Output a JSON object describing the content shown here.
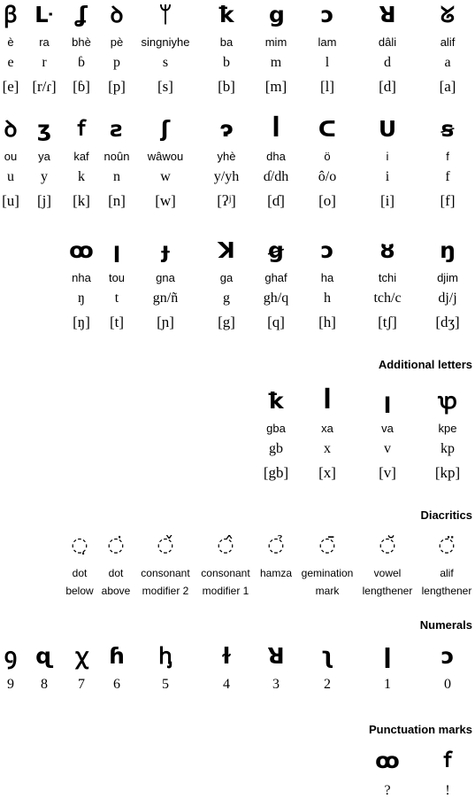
{
  "main_rows": [
    [
      {
        "glyph": "ꞵ",
        "name": "è",
        "roman": "e",
        "ipa": "[e]"
      },
      {
        "glyph": "ᒷ",
        "name": "ra",
        "roman": "r",
        "ipa": "[r/ɾ]"
      },
      {
        "glyph": "ʆ",
        "name": "bhè",
        "roman": "ɓ",
        "ipa": "[ɓ]"
      },
      {
        "glyph": "ꝺ",
        "name": "pè",
        "roman": "p",
        "ipa": "[p]"
      },
      {
        "glyph": "ᛘ",
        "name": "singniyhe",
        "roman": "s",
        "ipa": "[s]"
      },
      {
        "glyph": "ꝁ",
        "name": "ba",
        "roman": "b",
        "ipa": "[b]"
      },
      {
        "glyph": "ց",
        "name": "mim",
        "roman": "m",
        "ipa": "[m]"
      },
      {
        "glyph": "ↄ",
        "name": "lam",
        "roman": "l",
        "ipa": "[l]"
      },
      {
        "glyph": "ꓤ",
        "name": "dâli",
        "roman": "d",
        "ipa": "[d]"
      },
      {
        "glyph": "ᘜ",
        "name": "alif",
        "roman": "a",
        "ipa": "[a]"
      }
    ],
    [
      {
        "glyph": "ꝺ",
        "name": "ou",
        "roman": "u",
        "ipa": "[u]"
      },
      {
        "glyph": "ʒ",
        "name": "ya",
        "roman": "y",
        "ipa": "[j]"
      },
      {
        "glyph": "ꬵ",
        "name": "kaf",
        "roman": "k",
        "ipa": "[k]"
      },
      {
        "glyph": "ƨ",
        "name": "noûn",
        "roman": "n",
        "ipa": "[n]"
      },
      {
        "glyph": "ʃ",
        "name": "wâwou",
        "roman": "w",
        "ipa": "[w]"
      },
      {
        "glyph": "ɂ",
        "name": "yhè",
        "roman": "y/yh",
        "ipa": "[ʔʲ]"
      },
      {
        "glyph": "ꟾ",
        "name": "dha",
        "roman": "ɗ/dh",
        "ipa": "[ɗ]"
      },
      {
        "glyph": "ᑕ",
        "name": "ö",
        "roman": "ô/o",
        "ipa": "[o]"
      },
      {
        "glyph": "ᑌ",
        "name": "i",
        "roman": "i",
        "ipa": "[i]"
      },
      {
        "glyph": "ꞩ",
        "name": "f",
        "roman": "f",
        "ipa": "[f]"
      }
    ],
    [
      {
        "glyph": "ꝏ",
        "name": "nha",
        "roman": "ŋ",
        "ipa": "[ŋ]"
      },
      {
        "glyph": "ꞁ",
        "name": "tou",
        "roman": "t",
        "ipa": "[t]"
      },
      {
        "glyph": "ɟ",
        "name": "gna",
        "roman": "gn/ñ",
        "ipa": "[ɲ]"
      },
      {
        "glyph": "ꓘ",
        "name": "ga",
        "roman": "g",
        "ipa": "[g]"
      },
      {
        "glyph": "ꞡ",
        "name": "ghaf",
        "roman": "gh/q",
        "ipa": "[q]"
      },
      {
        "glyph": "ↄ",
        "name": "ha",
        "roman": "h",
        "ipa": "[h]"
      },
      {
        "glyph": "ȣ",
        "name": "tchi",
        "roman": "tch/c",
        "ipa": "[tʃ]"
      },
      {
        "glyph": "ŋ",
        "name": "djim",
        "roman": "dj/j",
        "ipa": "[dʒ]"
      }
    ]
  ],
  "sections": {
    "additional": "Additional letters",
    "diacritics": "Diacritics",
    "numerals": "Numerals",
    "punctuation": "Punctuation marks"
  },
  "additional_letters": [
    {
      "glyph": "ꝁ",
      "name": "gba",
      "roman": "gb",
      "ipa": "[gb]"
    },
    {
      "glyph": "ꟾ",
      "name": "xa",
      "roman": "x",
      "ipa": "[x]"
    },
    {
      "glyph": "ꞁ",
      "name": "va",
      "roman": "v",
      "ipa": "[v]"
    },
    {
      "glyph": "ꝕ",
      "name": "kpe",
      "roman": "kp",
      "ipa": "[kp]"
    }
  ],
  "diacritics": [
    {
      "glyph": "◌̣",
      "line1": "dot",
      "line2": "below"
    },
    {
      "glyph": "◌̇",
      "line1": "dot",
      "line2": "above"
    },
    {
      "glyph": "◌̌",
      "line1": "consonant",
      "line2": "modifier 2"
    },
    {
      "glyph": "◌̂",
      "line1": "consonant",
      "line2": "modifier 1"
    },
    {
      "glyph": "◌̉",
      "line1": "hamza",
      "line2": ""
    },
    {
      "glyph": "◌̄",
      "line1": "gemination",
      "line2": "mark"
    },
    {
      "glyph": "◌̆",
      "line1": "vowel",
      "line2": "lengthener"
    },
    {
      "glyph": "◌̈",
      "line1": "alif",
      "line2": "lengthener"
    }
  ],
  "numerals": [
    {
      "glyph": "ꝯ",
      "digit": "9"
    },
    {
      "glyph": "ɋ",
      "digit": "8"
    },
    {
      "glyph": "ꭓ",
      "digit": "7"
    },
    {
      "glyph": "ɦ",
      "digit": "6"
    },
    {
      "glyph": "ꞕ",
      "digit": "5"
    },
    {
      "glyph": "ɫ",
      "digit": "4"
    },
    {
      "glyph": "ꓤ",
      "digit": "3"
    },
    {
      "glyph": "ʅ",
      "digit": "2"
    },
    {
      "glyph": "ǀ",
      "digit": "1"
    },
    {
      "glyph": "ↄ",
      "digit": "0"
    }
  ],
  "punctuation": [
    {
      "glyph": "ꝏ",
      "mark": "?"
    },
    {
      "glyph": "ꬵ",
      "mark": "!"
    }
  ]
}
